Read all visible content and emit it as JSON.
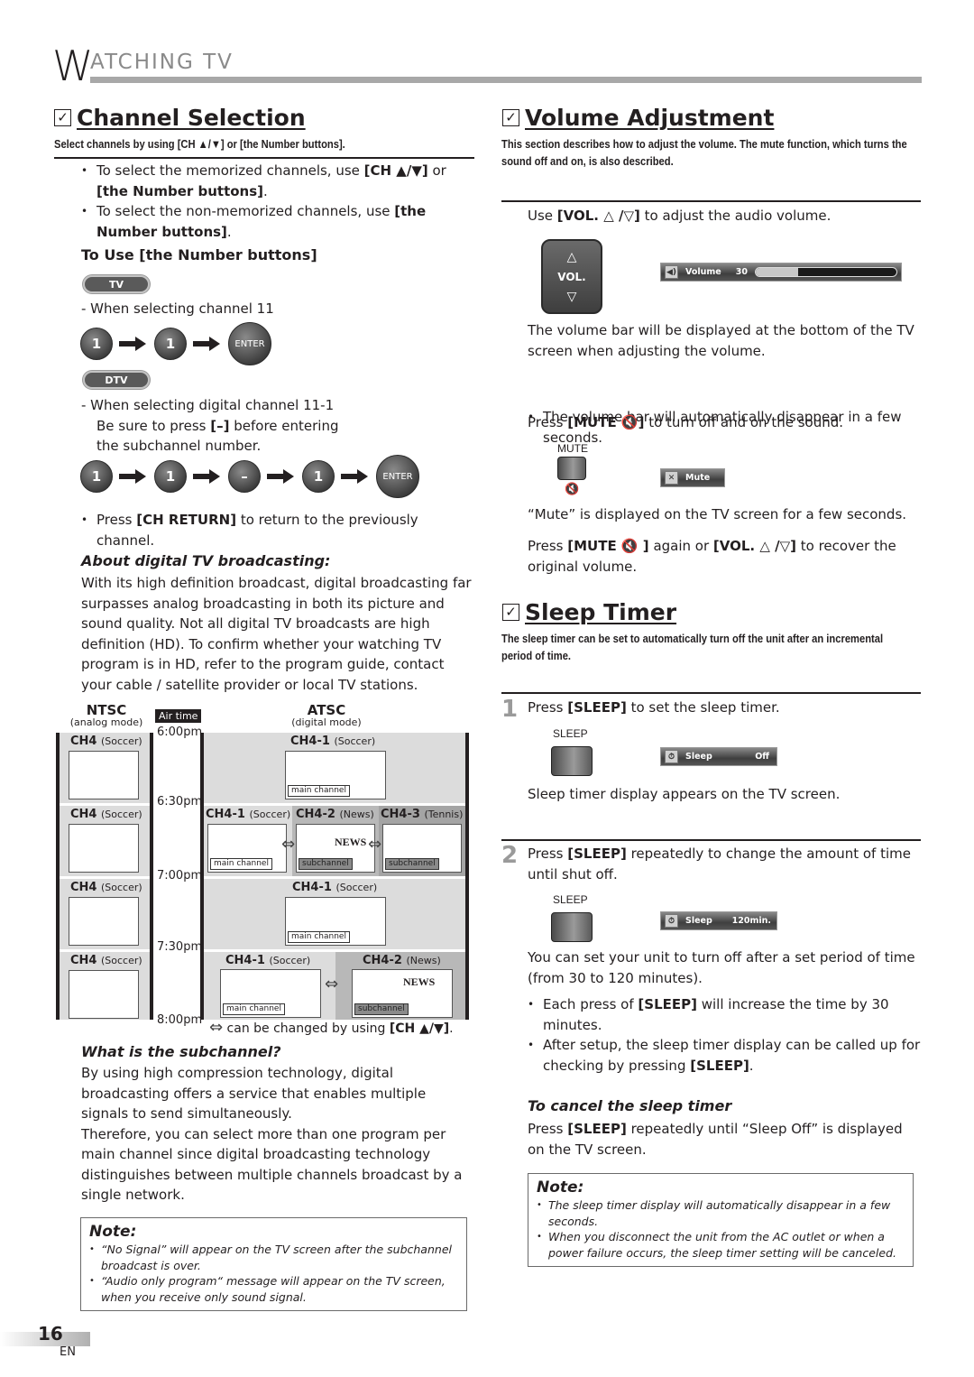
{
  "header": {
    "initial": "W",
    "rest": "ATCHING  TV"
  },
  "channel_selection": {
    "title": "Channel Selection",
    "subtitle": "Select channels by using [CH ▲/▼] or [the Number buttons].",
    "bullets": [
      {
        "pre": "To select the memorized channels, use ",
        "b1": "[CH ▲/▼]",
        "mid": " or ",
        "b2": "[the Number buttons]",
        "post": "."
      },
      {
        "pre": "To select the non-memorized channels, use ",
        "b1": "[the Number buttons]",
        "post": "."
      }
    ],
    "number_heading": "To Use [the Number buttons]",
    "tv_pill": "TV",
    "tv_note": "-  When selecting channel 11",
    "tv_sequence": [
      "1",
      "1",
      "ENTER"
    ],
    "dtv_pill": "DTV",
    "dtv_note_line1": "-  When selecting digital channel 11-1",
    "dtv_note_line2_pre": "Be sure to press ",
    "dtv_note_line2_b": "[–]",
    "dtv_note_line2_post": " before entering",
    "dtv_note_line3": "the subchannel number.",
    "dtv_sequence": [
      "1",
      "1",
      "–",
      "1",
      "ENTER"
    ],
    "ch_return": {
      "pre": "Press ",
      "b": "[CH RETURN]",
      "post": " to return to the previously channel."
    },
    "about_heading": "About digital TV broadcasting:",
    "about_text": "With its high definition broadcast, digital broadcasting far surpasses analog broadcasting in both its picture and sound quality. Not all digital TV broadcasts are high definition (HD). To confirm whether your watching TV program is in HD, refer to the program guide, contact your cable / satellite provider or local TV stations.",
    "diagram": {
      "ntsc_label": "NTSC",
      "ntsc_sub": "(analog mode)",
      "airtime_label": "Air time",
      "atsc_label": "ATSC",
      "atsc_sub": "(digital mode)",
      "times": [
        "6:00pm",
        "6:30pm",
        "7:00pm",
        "7:30pm",
        "8:00pm"
      ],
      "ntsc_rows": [
        {
          "ch": "CH4",
          "prog": "(Soccer)"
        },
        {
          "ch": "CH4",
          "prog": "(Soccer)"
        },
        {
          "ch": "CH4",
          "prog": "(Soccer)"
        },
        {
          "ch": "CH4",
          "prog": "(Soccer)"
        }
      ],
      "atsc_rows": [
        [
          {
            "ch": "CH4-1",
            "prog": "(Soccer)",
            "tag": "main channel"
          }
        ],
        [
          {
            "ch": "CH4-1",
            "prog": "(Soccer)",
            "tag": "main channel"
          },
          {
            "ch": "CH4-2",
            "prog": "(News)",
            "tag": "subchannel"
          },
          {
            "ch": "CH4-3",
            "prog": "(Tennis)",
            "tag": "subchannel"
          }
        ],
        [
          {
            "ch": "CH4-1",
            "prog": "(Soccer)",
            "tag": "main channel"
          }
        ],
        [
          {
            "ch": "CH4-1",
            "prog": "(Soccer)",
            "tag": "main channel"
          },
          {
            "ch": "CH4-2",
            "prog": "(News)",
            "tag": "subchannel"
          }
        ]
      ],
      "news_word": "NEWS",
      "legend_pre": "can be changed by using ",
      "legend_b": "[CH ▲/▼]",
      "legend_post": "."
    },
    "subchannel_heading": "What is the subchannel?",
    "subchannel_text1": "By using high compression technology, digital broadcasting offers a service that enables multiple signals to send simultaneously.",
    "subchannel_text2": "Therefore, you can select more than one program per main channel since digital broadcasting technology distinguishes between multiple channels broadcast by a single network.",
    "note": {
      "heading": "Note:",
      "items": [
        "“No Signal” will appear on the TV screen after the subchannel broadcast is over.",
        "“Audio only program“ message will appear on the TV screen, when you receive only sound signal."
      ]
    }
  },
  "volume_adjustment": {
    "title": "Volume Adjustment",
    "subtitle": "This section describes how to adjust the volume. The mute function, which turns the sound off and on, is also described.",
    "use_pre": "Use ",
    "use_b": "[VOL. △ /▽]",
    "use_post": " to adjust the audio volume.",
    "vol_button_label": "VOL.",
    "osd_volume": {
      "label": "Volume",
      "value": "30",
      "level": 0.3
    },
    "bar_text": "The volume bar will be displayed at the bottom of the TV screen when adjusting the volume.",
    "bar_bullet": "The volume bar will automatically disappear in a few seconds.",
    "mute_pre": "Press ",
    "mute_b": "[MUTE 🔇]",
    "mute_post": " to turn off and on the sound.",
    "mute_button_label": "MUTE",
    "osd_mute": {
      "label": "Mute"
    },
    "mute_display_text": "“Mute” is displayed on the TV screen for a few seconds.",
    "recover_pre": "Press ",
    "recover_b1": "[MUTE 🔇 ]",
    "recover_mid": " again or ",
    "recover_b2": "[VOL. △ /▽]",
    "recover_post": " to recover the original volume."
  },
  "sleep_timer": {
    "title": "Sleep Timer",
    "subtitle": "The sleep timer can be set to automatically turn off the unit after an incremental period of time.",
    "step1": {
      "num": "1",
      "pre": "Press ",
      "b": "[SLEEP]",
      "post": " to set the sleep timer."
    },
    "sleep_button_label": "SLEEP",
    "osd_step1": {
      "label": "Sleep",
      "value": "Off"
    },
    "step1_text": "Sleep timer display appears on the TV screen.",
    "step2": {
      "num": "2",
      "pre": "Press ",
      "b": "[SLEEP]",
      "post": " repeatedly to change the amount of time until shut off."
    },
    "osd_step2": {
      "label": "Sleep",
      "value": "120min."
    },
    "step2_text": "You can set your unit to turn off after a set period of time (from 30 to 120 minutes).",
    "bullets": [
      {
        "pre": "Each press of ",
        "b": "[SLEEP]",
        "post": " will increase the time by 30 minutes."
      },
      {
        "pre": "After setup, the sleep timer display can be called up for checking by pressing ",
        "b": "[SLEEP]",
        "post": "."
      }
    ],
    "cancel_heading": "To cancel the sleep timer",
    "cancel_pre": "Press ",
    "cancel_b": "[SLEEP]",
    "cancel_post": " repeatedly until “Sleep Off” is displayed on the TV screen.",
    "note": {
      "heading": "Note:",
      "items": [
        "The sleep timer display will automatically disappear in a few seconds.",
        "When you disconnect the unit from the AC outlet or when a power failure occurs, the sleep timer setting will be canceled."
      ]
    }
  },
  "footer": {
    "page_number": "16",
    "language": "EN"
  }
}
